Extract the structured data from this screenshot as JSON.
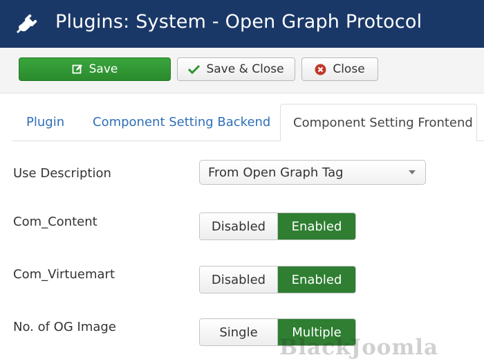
{
  "header": {
    "title": "Plugins: System - Open Graph Protocol",
    "icon": "plug-icon"
  },
  "toolbar": {
    "save_label": "Save",
    "save_close_label": "Save & Close",
    "close_label": "Close"
  },
  "tabs": [
    {
      "label": "Plugin",
      "active": false
    },
    {
      "label": "Component Setting Backend",
      "active": false
    },
    {
      "label": "Component Setting Frontend",
      "active": true
    }
  ],
  "fields": {
    "use_description": {
      "label": "Use Description",
      "value": "From Open Graph Tag"
    },
    "com_content": {
      "label": "Com_Content",
      "off": "Disabled",
      "on": "Enabled",
      "selected": "Enabled"
    },
    "com_virtuemart": {
      "label": "Com_Virtuemart",
      "off": "Disabled",
      "on": "Enabled",
      "selected": "Enabled"
    },
    "og_image": {
      "label": "No. of OG Image",
      "off": "Single",
      "on": "Multiple",
      "selected": "Multiple"
    }
  },
  "watermark": "BlackJoomla",
  "colors": {
    "header_bg": "#1a3867",
    "save_green": "#2e9431",
    "toggle_active": "#2f7e32",
    "link_blue": "#2e6fb8",
    "close_red": "#c0392b"
  }
}
